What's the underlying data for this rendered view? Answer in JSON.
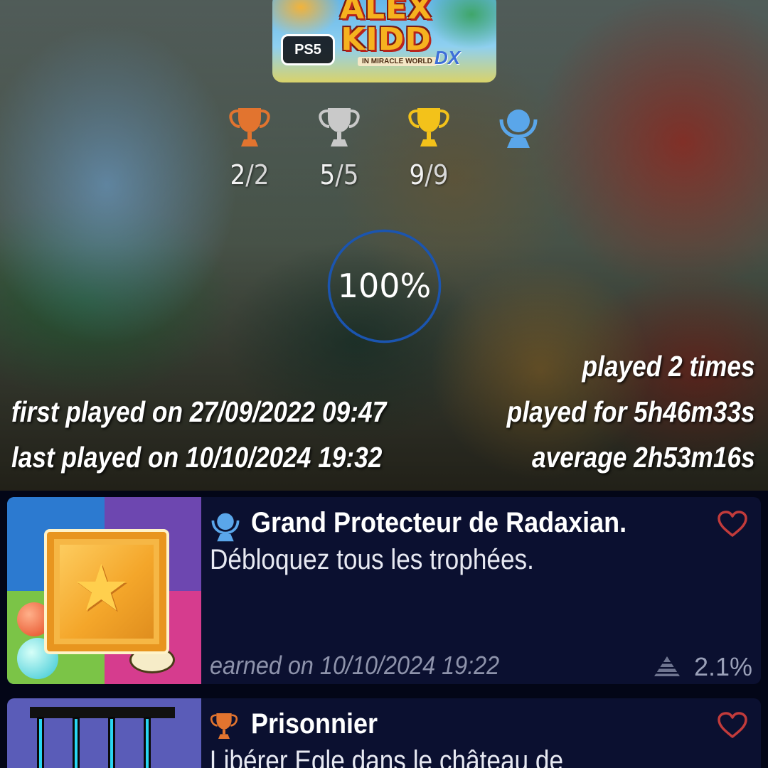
{
  "game": {
    "cover_title_line1": "ALEX",
    "cover_title_line2": "KIDD",
    "cover_subtitle": "IN MIRACLE WORLD",
    "cover_suffix": "DX",
    "platform_badge": "PS5"
  },
  "trophy_counts": [
    {
      "type": "bronze",
      "earned": "2",
      "total": "2",
      "color": "#e2742f"
    },
    {
      "type": "silver",
      "earned": "5",
      "total": "5",
      "color": "#c9c9c9"
    },
    {
      "type": "gold",
      "earned": "9",
      "total": "9",
      "color": "#f3c21a"
    },
    {
      "type": "platinum",
      "color": "#5aa6ea"
    }
  ],
  "separator": "/",
  "progress": {
    "label": "100%",
    "value": 1.0,
    "ring_color": "#1b55b0"
  },
  "play_stats": {
    "times": "played 2 times",
    "first_played": "first played on 27/09/2022 09:47",
    "duration": "played for 5h46m33s",
    "last_played": "last played on 10/10/2024 19:32",
    "average": "average 2h53m16s"
  },
  "trophies": [
    {
      "type": "platinum",
      "name": "Grand Protecteur de Radaxian.",
      "description": "Débloquez tous les trophées.",
      "earned": "earned on 10/10/2024 19:22",
      "rarity": "2.1%"
    },
    {
      "type": "bronze",
      "name": "Prisonnier",
      "description": "Libérer Egle dans le château de"
    }
  ],
  "colors": {
    "list_background": "#030617",
    "card_background": "#0b1030",
    "heart": "#c23b3b"
  }
}
